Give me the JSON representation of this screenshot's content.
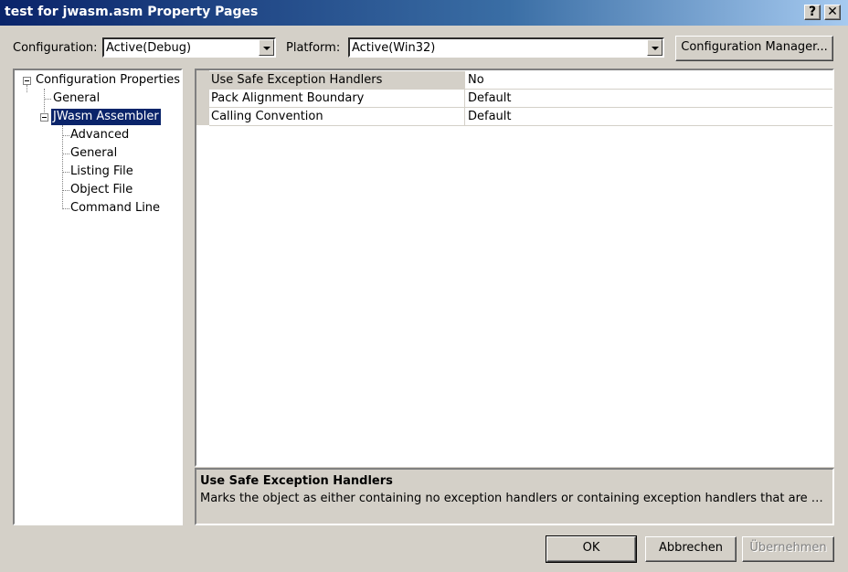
{
  "window": {
    "title": "test for jwasm.asm Property Pages",
    "help_glyph": "?",
    "close_glyph": "✕"
  },
  "toolbar": {
    "configuration_label": "Configuration:",
    "configuration_value": "Active(Debug)",
    "platform_label": "Platform:",
    "platform_value": "Active(Win32)",
    "config_manager_label": "Configuration Manager..."
  },
  "tree": {
    "root": "Configuration Properties",
    "general": "General",
    "assembler": "JWasm Assembler",
    "children": [
      "Advanced",
      "General",
      "Listing File",
      "Object File",
      "Command Line"
    ]
  },
  "properties": [
    {
      "name": "Use Safe Exception Handlers",
      "value": "No"
    },
    {
      "name": "Pack Alignment Boundary",
      "value": "Default"
    },
    {
      "name": "Calling Convention",
      "value": "Default"
    }
  ],
  "description": {
    "title": "Use Safe Exception Handlers",
    "text": "Marks the object as either containing no exception handlers or containing exception handlers that are a..."
  },
  "buttons": {
    "ok": "OK",
    "cancel": "Abbrechen",
    "apply": "Übernehmen"
  }
}
